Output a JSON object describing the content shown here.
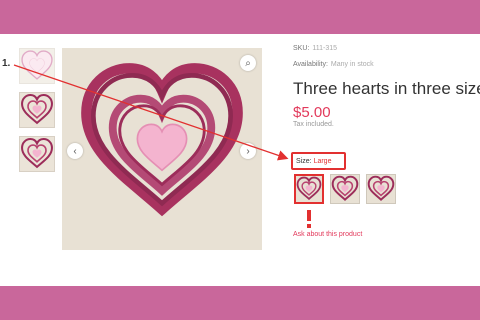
{
  "product": {
    "sku_label": "SKU:",
    "sku_value": "111-315",
    "availability_label": "Availability:",
    "availability_value": "Many in stock",
    "title": "Three hearts in three sizes",
    "price": "$5.00",
    "tax_note": "Tax included."
  },
  "size": {
    "label": "Size:",
    "selected": "Large",
    "options": [
      "large",
      "medium",
      "small"
    ]
  },
  "ask_link": "Ask about this product",
  "annotation": {
    "step_label": "1.",
    "marker_color": "#e23030"
  },
  "gallery": {
    "thumbnails": [
      "heart-thumbnail-1",
      "heart-thumbnail-2",
      "heart-thumbnail-3"
    ],
    "icons": {
      "zoom": "zoom-icon",
      "prev": "chevron-left-icon",
      "next": "chevron-right-icon"
    }
  },
  "colors": {
    "band": "#c9679b",
    "price": "#e2395b",
    "heart_dark": "#9c2d5a",
    "heart_light": "#f4b4cf",
    "fabric": "#e8e1d4"
  }
}
